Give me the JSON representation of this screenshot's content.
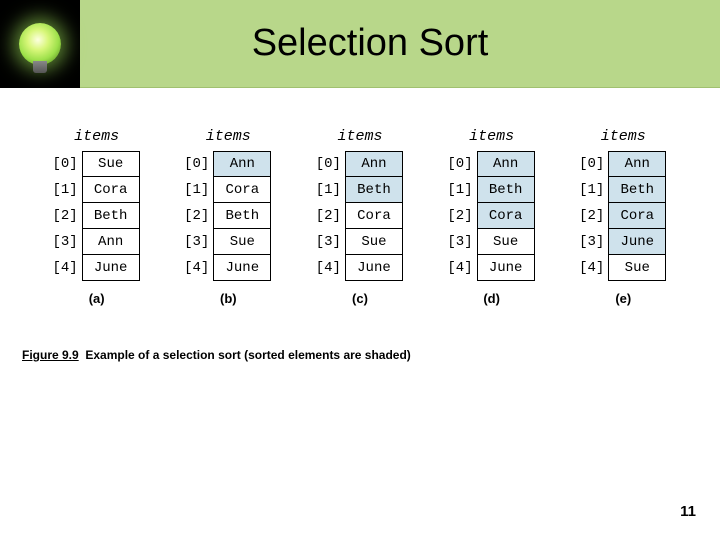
{
  "title": "Selection Sort",
  "caption_fig": "Figure 9.9",
  "caption_text": "Example of a selection sort (sorted elements are shaded)",
  "page_number": "11",
  "chart_data": {
    "type": "table",
    "title": "Selection Sort steps",
    "header_label": "items",
    "indices": [
      "[0]",
      "[1]",
      "[2]",
      "[3]",
      "[4]"
    ],
    "columns": [
      {
        "label": "(a)",
        "values": [
          "Sue",
          "Cora",
          "Beth",
          "Ann",
          "June"
        ],
        "shaded": [
          false,
          false,
          false,
          false,
          false
        ]
      },
      {
        "label": "(b)",
        "values": [
          "Ann",
          "Cora",
          "Beth",
          "Sue",
          "June"
        ],
        "shaded": [
          true,
          false,
          false,
          false,
          false
        ]
      },
      {
        "label": "(c)",
        "values": [
          "Ann",
          "Beth",
          "Cora",
          "Sue",
          "June"
        ],
        "shaded": [
          true,
          true,
          false,
          false,
          false
        ]
      },
      {
        "label": "(d)",
        "values": [
          "Ann",
          "Beth",
          "Cora",
          "Sue",
          "June"
        ],
        "shaded": [
          true,
          true,
          true,
          false,
          false
        ]
      },
      {
        "label": "(e)",
        "values": [
          "Ann",
          "Beth",
          "Cora",
          "June",
          "Sue"
        ],
        "shaded": [
          true,
          true,
          true,
          true,
          false
        ]
      }
    ]
  }
}
